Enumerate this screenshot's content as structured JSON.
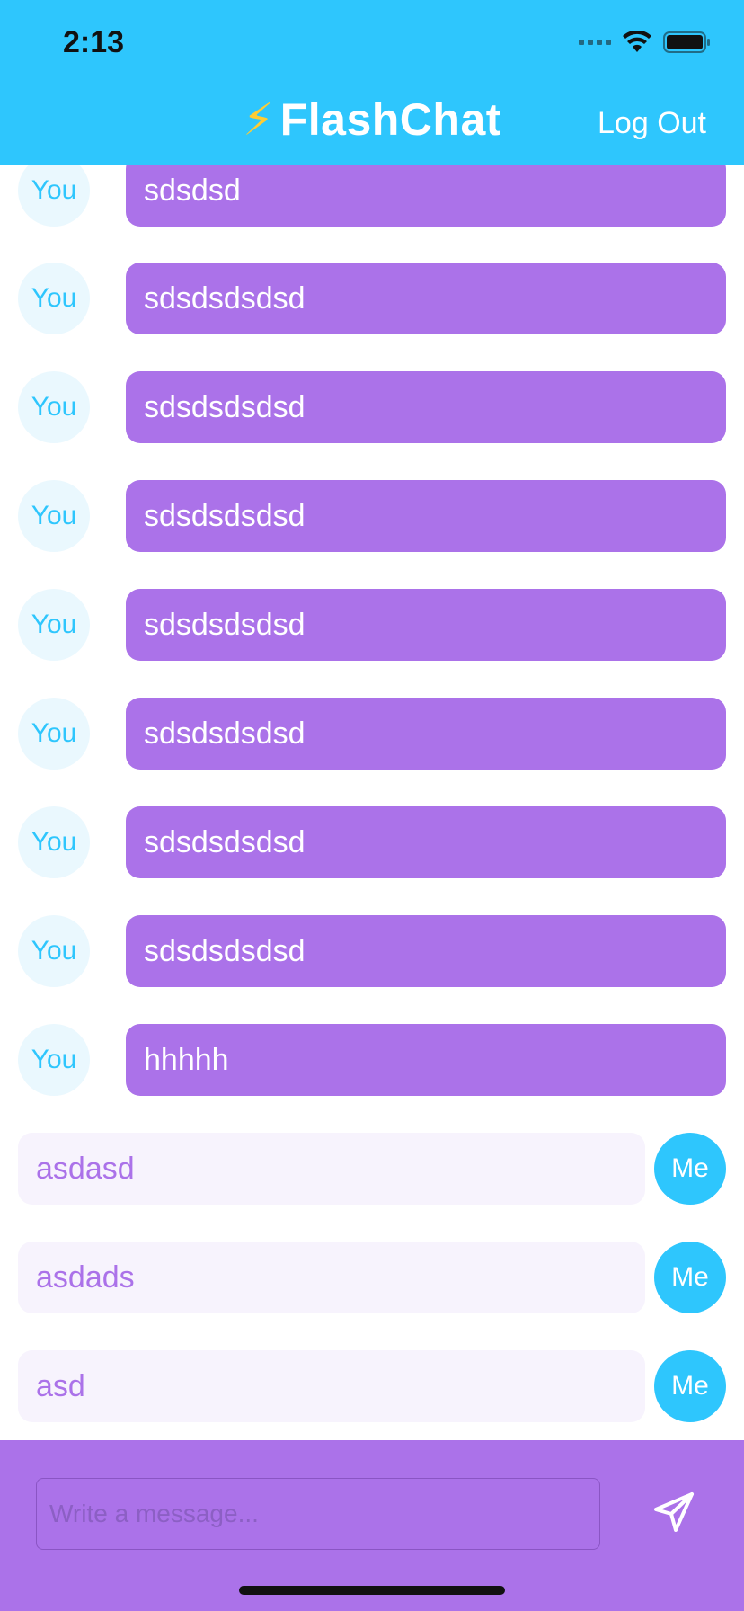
{
  "status_bar": {
    "time": "2:13"
  },
  "nav": {
    "bolt": "⚡",
    "title": "FlashChat",
    "logout_label": "Log Out"
  },
  "messages": [
    {
      "sender": "You",
      "text": "sdsdsd"
    },
    {
      "sender": "You",
      "text": "sdsdsdsdsd"
    },
    {
      "sender": "You",
      "text": "sdsdsdsdsd"
    },
    {
      "sender": "You",
      "text": "sdsdsdsdsd"
    },
    {
      "sender": "You",
      "text": "sdsdsdsdsd"
    },
    {
      "sender": "You",
      "text": "sdsdsdsdsd"
    },
    {
      "sender": "You",
      "text": "sdsdsdsdsd"
    },
    {
      "sender": "You",
      "text": "sdsdsdsdsd"
    },
    {
      "sender": "You",
      "text": "hhhhh"
    },
    {
      "sender": "Me",
      "text": "asdasd"
    },
    {
      "sender": "Me",
      "text": "asdads"
    },
    {
      "sender": "Me",
      "text": "asd"
    }
  ],
  "composer": {
    "placeholder": "Write a message...",
    "value": ""
  },
  "icons": {
    "send": "paperplane-icon",
    "wifi": "wifi-icon",
    "battery": "battery-icon",
    "signal": "signal-icon"
  },
  "colors": {
    "brand_blue": "#2ec6fd",
    "brand_purple": "#ab72e9",
    "light_purple": "#f7f3fd"
  }
}
